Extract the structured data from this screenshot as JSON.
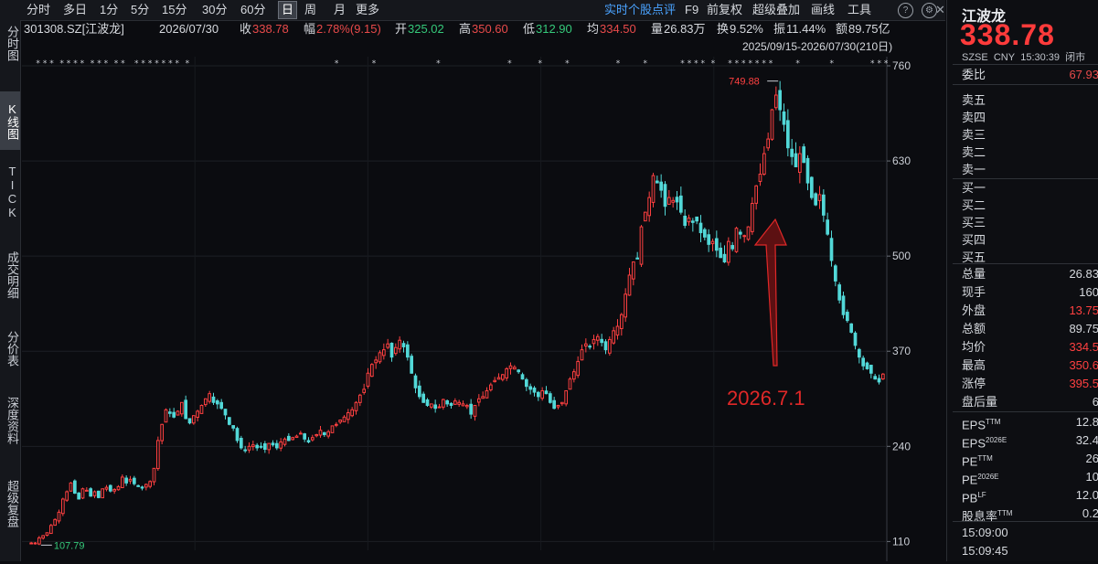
{
  "sidebar": {
    "tabs": [
      {
        "label": "分时图",
        "active": false
      },
      {
        "label": "K线图",
        "active": true
      },
      {
        "label": "TICK",
        "active": false
      },
      {
        "label": "成交明细",
        "active": false
      },
      {
        "label": "分价表",
        "active": false
      },
      {
        "label": "深度资料",
        "active": false
      },
      {
        "label": "超级复盘",
        "active": false
      }
    ]
  },
  "toolbar": {
    "periods": [
      "分时",
      "多日",
      "1分",
      "5分",
      "15分",
      "30分",
      "60分",
      "日",
      "周",
      "月",
      "更多"
    ],
    "active_period": "日",
    "right": [
      "实时个股点评",
      "F9",
      "前复权",
      "超级叠加",
      "画线",
      "工具"
    ]
  },
  "info": {
    "code": "301308.SZ[江波龙]",
    "date": "2026/07/30",
    "close_label": "收",
    "close": "338.78",
    "change_label": "幅",
    "change": "2.78%(9.15)",
    "open_label": "开",
    "open": "325.02",
    "high_label": "高",
    "high": "350.60",
    "low_label": "低",
    "low": "312.90",
    "avg_label": "均",
    "avg": "334.50",
    "volume_label": "量",
    "volume": "26.83万",
    "turnover_label": "换",
    "turnover": "9.52%",
    "amplitude_label": "振",
    "amplitude": "11.44%",
    "amount_label": "额",
    "amount": "89.75亿",
    "range": "2025/09/15-2026/07/30(210日)"
  },
  "chart_data": {
    "type": "candlestick",
    "y_ticks": [
      760,
      630,
      500,
      370,
      240,
      110
    ],
    "ylim": [
      98,
      770
    ],
    "n_days": 210,
    "high_marker": "749.88",
    "low_marker": "107.79",
    "annotation": "2026.7.1",
    "colors": {
      "up": "#ff4040",
      "down": "#52d8d8",
      "annotation": "#e02828"
    },
    "closes": [
      108,
      108,
      115,
      118,
      122,
      132,
      140,
      150,
      168,
      178,
      190,
      176,
      168,
      182,
      180,
      172,
      178,
      170,
      182,
      184,
      179,
      181,
      185,
      198,
      190,
      195,
      189,
      186,
      183,
      188,
      192,
      210,
      248,
      270,
      290,
      285,
      280,
      288,
      300,
      278,
      272,
      282,
      288,
      296,
      305,
      312,
      300,
      298,
      292,
      283,
      270,
      265,
      248,
      238,
      235,
      240,
      242,
      238,
      240,
      236,
      244,
      242,
      238,
      246,
      250,
      248,
      252,
      254,
      258,
      250,
      246,
      252,
      256,
      262,
      256,
      260,
      268,
      270,
      276,
      280,
      286,
      290,
      300,
      310,
      318,
      340,
      352,
      358,
      368,
      372,
      380,
      362,
      375,
      385,
      376,
      362,
      340,
      320,
      308,
      300,
      296,
      298,
      292,
      294,
      304,
      298,
      296,
      302,
      300,
      298,
      296,
      284,
      296,
      305,
      308,
      316,
      324,
      330,
      334,
      338,
      346,
      350,
      348,
      342,
      332,
      322,
      318,
      314,
      308,
      316,
      312,
      300,
      292,
      296,
      300,
      316,
      332,
      342,
      356,
      372,
      380,
      376,
      386,
      390,
      382,
      372,
      386,
      398,
      404,
      420,
      448,
      474,
      492,
      496,
      540,
      560,
      580,
      610,
      600,
      590,
      568,
      580,
      576,
      574,
      560,
      542,
      552,
      546,
      548,
      532,
      526,
      516,
      520,
      508,
      498,
      492,
      520,
      510,
      538,
      530,
      528,
      540,
      572,
      596,
      612,
      640,
      660,
      700,
      720,
      700,
      680,
      648,
      636,
      622,
      640,
      628,
      600,
      580,
      570,
      584,
      556,
      530,
      494,
      466,
      440,
      420,
      412,
      396,
      378,
      362,
      350,
      346,
      340,
      332,
      328,
      338.78
    ]
  },
  "panel": {
    "name": "江波龙",
    "price": "338.78",
    "market": "SZSE",
    "currency": "CNY",
    "time": "15:30:39",
    "status": "闭市",
    "wei_label": "委比",
    "wei_value": "67.93",
    "sell": [
      "卖五",
      "卖四",
      "卖三",
      "卖二",
      "卖一"
    ],
    "buy": [
      "买一",
      "买二",
      "买三",
      "买四",
      "买五"
    ],
    "stats": [
      {
        "k": "总量",
        "v": "26.83",
        "color": "#d6d9de"
      },
      {
        "k": "现手",
        "v": "160",
        "color": "#d6d9de"
      },
      {
        "k": "外盘",
        "v": "13.75",
        "color": "#ff4040"
      },
      {
        "k": "总额",
        "v": "89.75",
        "color": "#d6d9de"
      },
      {
        "k": "均价",
        "v": "334.5",
        "color": "#ff4040"
      },
      {
        "k": "最高",
        "v": "350.6",
        "color": "#ff4040"
      },
      {
        "k": "涨停",
        "v": "395.5",
        "color": "#ff4040"
      },
      {
        "k": "盘后量",
        "v": "6",
        "color": "#d6d9de"
      }
    ],
    "fund": [
      {
        "k": "EPS",
        "sup": "TTM",
        "v": "12.8"
      },
      {
        "k": "EPS",
        "sup": "2026E",
        "v": "32.4"
      },
      {
        "k": "PE",
        "sup": "TTM",
        "v": "26"
      },
      {
        "k": "PE",
        "sup": "2026E",
        "v": "10"
      },
      {
        "k": "PB",
        "sup": "LF",
        "v": "12.0"
      },
      {
        "k": "股息率",
        "sup": "TTM",
        "v": "0.2"
      }
    ],
    "times": [
      "15:09:00",
      "15:09:45"
    ]
  }
}
